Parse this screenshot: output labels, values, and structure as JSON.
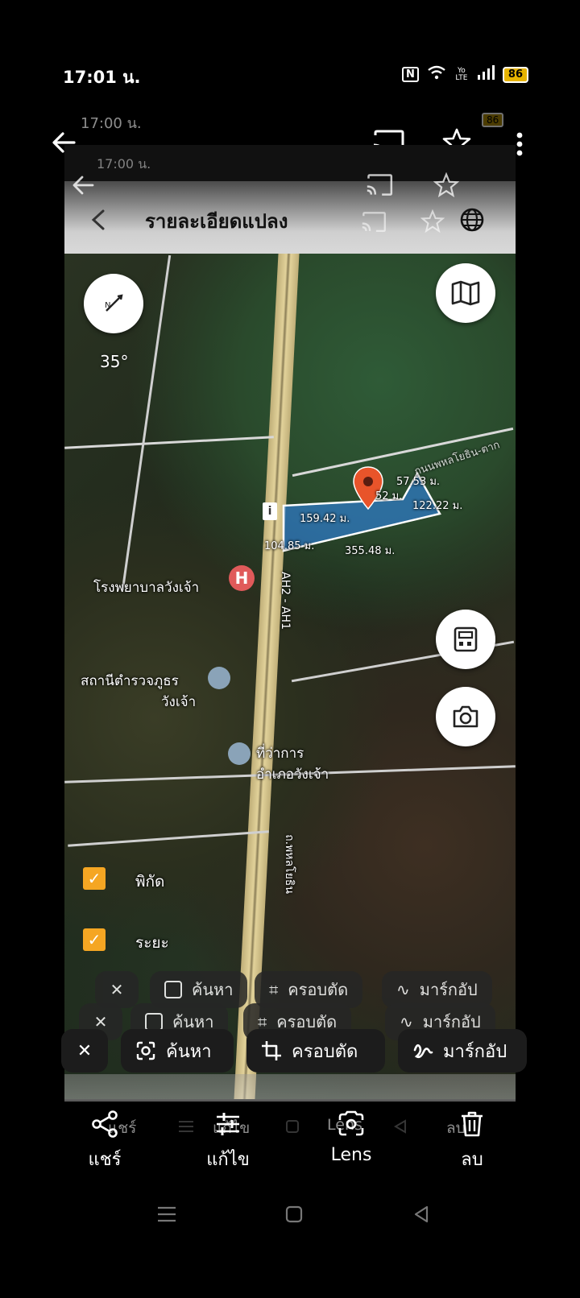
{
  "status": {
    "time": "17:01 น.",
    "battery": "86",
    "nfc_label": "N",
    "volte_label": "Yo LTE"
  },
  "ghost_status_1": {
    "time": "17:00 น.",
    "battery": "86"
  },
  "ghost_status_2": {
    "time": "17:00 น.",
    "battery": "86"
  },
  "header": {
    "title": "รายละเอียดแปลง"
  },
  "map": {
    "compass_bearing": "35°",
    "measurements": [
      "57.53 ม.",
      "52 ม.",
      "122.22 ม.",
      "159.42 ม.",
      "104.85 ม.",
      "355.48 ม."
    ],
    "place_labels": {
      "hospital": "โรงพยาบาลวังเจ้า",
      "police_line1": "สถานีตำรวจภูธร",
      "police_line2": "วังเจ้า",
      "district_line1": "ที่ว่าการ",
      "district_line2": "อำเภอวังเจ้า",
      "road_ah": "AH2 - AH1",
      "road_name": "ถ.พหลโยธิน",
      "road_ne": "ถนนพหลโยธิน-ตาก"
    }
  },
  "layers": [
    {
      "label": "พิกัด",
      "checked": true
    },
    {
      "label": "ระยะ",
      "checked": true
    }
  ],
  "lens_toolbar": {
    "close": "✕",
    "search": "ค้นหา",
    "crop": "ครอบตัด",
    "markup": "มาร์กอัป"
  },
  "bottom_actions": [
    {
      "label": "แชร์",
      "icon": "share-icon"
    },
    {
      "label": "แก้ไข",
      "icon": "edit-sliders-icon"
    },
    {
      "label": "Lens",
      "icon": "lens-icon"
    },
    {
      "label": "ลบ",
      "icon": "trash-icon"
    }
  ],
  "ghost_bottom": {
    "share": "แชร์",
    "edit": "แก้ไข",
    "lens": "Lens",
    "delete": "ลบ"
  },
  "colors": {
    "accent": "#f5a623",
    "pin": "#e8542a",
    "parcel": "#2f79c4"
  }
}
